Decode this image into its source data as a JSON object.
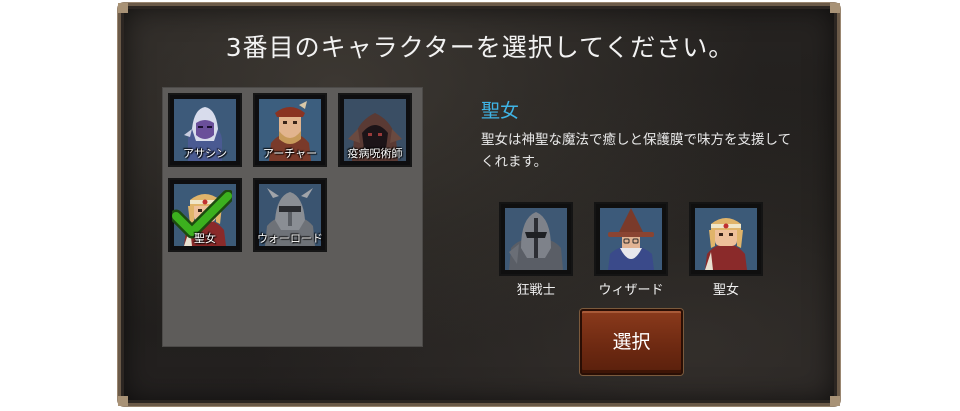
{
  "title": "3番目のキャラクターを選択してください。",
  "roster": [
    {
      "label": "アサシン",
      "icon": "assassin-portrait"
    },
    {
      "label": "アーチャー",
      "icon": "archer-portrait"
    },
    {
      "label": "疫病呪術師",
      "icon": "plague-warlock-portrait"
    },
    {
      "label": "聖女",
      "icon": "saint-portrait",
      "selected": true
    },
    {
      "label": "ウォーロード",
      "icon": "warlord-portrait"
    }
  ],
  "detail": {
    "name": "聖女",
    "description": "聖女は神聖な魔法で癒しと保護膜で味方を支援してくれます。"
  },
  "party": [
    {
      "label": "狂戦士",
      "icon": "berserker-portrait"
    },
    {
      "label": "ウィザード",
      "icon": "wizard-portrait"
    },
    {
      "label": "聖女",
      "icon": "saint-portrait"
    }
  ],
  "select_button": "選択",
  "colors": {
    "accent": "#3fb4e6",
    "button": "#6f2a12",
    "check": "#3cb01e"
  }
}
